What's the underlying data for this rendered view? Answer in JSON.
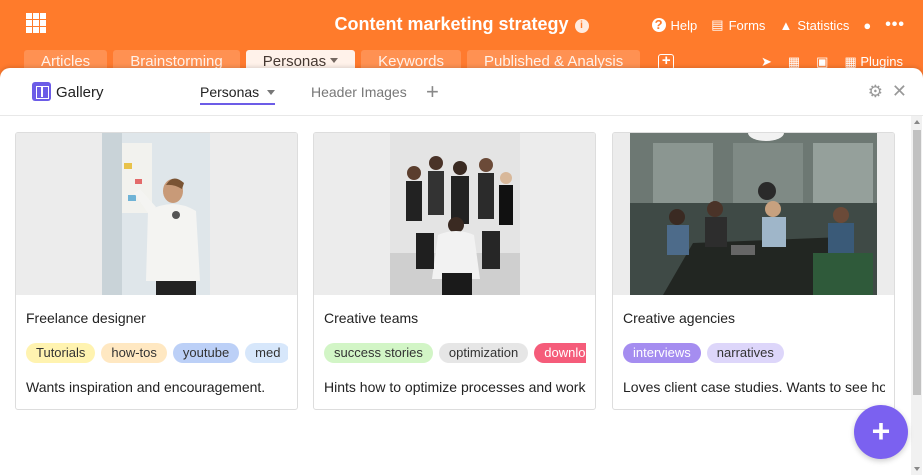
{
  "app": {
    "title": "Content marketing strategy",
    "actions": {
      "help": "Help",
      "forms": "Forms",
      "statistics": "Statistics"
    }
  },
  "tables": [
    {
      "label": "Articles"
    },
    {
      "label": "Brainstorming"
    },
    {
      "label": "Personas"
    },
    {
      "label": "Keywords"
    },
    {
      "label": "Published & Analysis"
    }
  ],
  "table_tools": {
    "plugins": "Plugins"
  },
  "modal": {
    "view_type": "Gallery",
    "views": [
      {
        "label": "Personas"
      },
      {
        "label": "Header Images"
      }
    ]
  },
  "cards": [
    {
      "title": "Freelance designer",
      "tags": [
        {
          "label": "Tutorials",
          "color": "#fff3b0"
        },
        {
          "label": "how-tos",
          "color": "#ffe8c2"
        },
        {
          "label": "youtube",
          "color": "#bcd0f7"
        },
        {
          "label": "med",
          "color": "#d7e7fb"
        }
      ],
      "description": "Wants inspiration and encouragement."
    },
    {
      "title": "Creative teams",
      "tags": [
        {
          "label": "success stories",
          "color": "#d2f5c6"
        },
        {
          "label": "optimization",
          "color": "#e6e6e6"
        },
        {
          "label": "downlo",
          "color": "#f55c7a"
        }
      ],
      "description": "Hints how to optimize processes and work"
    },
    {
      "title": "Creative agencies",
      "tags": [
        {
          "label": "interviews",
          "color": "#a58df0"
        },
        {
          "label": "narratives",
          "color": "#ddd6fa"
        }
      ],
      "description": "Loves client case studies. Wants to see ho"
    }
  ],
  "colors": {
    "brand": "#ff7b2b",
    "accent": "#6c5ce7"
  }
}
